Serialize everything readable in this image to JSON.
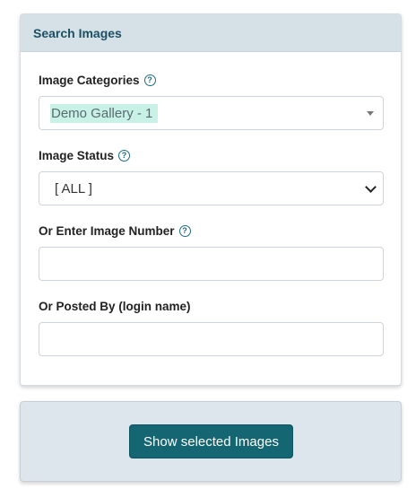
{
  "panel": {
    "title": "Search Images"
  },
  "fields": {
    "categories": {
      "label": "Image Categories",
      "help_icon": "question-circle-icon",
      "selected_value": "Demo Gallery - 1"
    },
    "status": {
      "label": "Image Status",
      "help_icon": "question-circle-icon",
      "selected_value": "[ ALL ]"
    },
    "image_number": {
      "label": "Or Enter Image Number",
      "help_icon": "question-circle-icon",
      "value": ""
    },
    "posted_by": {
      "label": "Or Posted By (login name)",
      "value": ""
    }
  },
  "actions": {
    "show_button": "Show selected Images"
  },
  "colors": {
    "header_bg": "#d6e1e7",
    "header_text": "#1b4f63",
    "button_bg": "#146673",
    "highlight": "#c9f2e6"
  }
}
